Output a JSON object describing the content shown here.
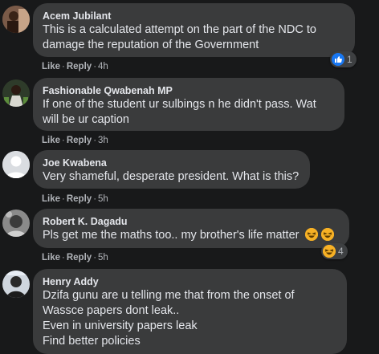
{
  "comments": [
    {
      "author": "Acem Jubilant",
      "text_lines": [
        "This is a calculated attempt on the part of the NDC to",
        "damage the reputation of the Government"
      ],
      "like_label": "Like",
      "reply_label": "Reply",
      "time": "4h",
      "reaction_icon": "like-icon",
      "reaction_count": "1"
    },
    {
      "author": "Fashionable Qwabenah MP",
      "text_lines": [
        "If one of the student ur sulbings n he didn't pass. Wat",
        "will be ur caption"
      ],
      "like_label": "Like",
      "reply_label": "Reply",
      "time": "3h"
    },
    {
      "author": "Joe Kwabena",
      "text_lines": [
        "Very shameful, desperate president. What is this?"
      ],
      "like_label": "Like",
      "reply_label": "Reply",
      "time": "5h"
    },
    {
      "author": "Robert K. Dagadu",
      "text_lines": [
        "Pls get me the maths too.. my brother's life matter"
      ],
      "like_label": "Like",
      "reply_label": "Reply",
      "time": "5h",
      "reaction_icon": "haha-icon",
      "reaction_count": "4"
    },
    {
      "author": "Henry Addy",
      "text_lines": [
        "Dzifa gunu are u telling me that from the onset of",
        "Wassce papers dont leak..",
        "Even in university papers leak",
        "Find better policies"
      ]
    }
  ],
  "colors": {
    "background": "#18191a",
    "bubble": "#3a3b3c",
    "text": "#e4e6eb",
    "secondary_text": "#b0b3b8",
    "like_blue": "#1877f2",
    "haha_yellow": "#f7b125"
  }
}
